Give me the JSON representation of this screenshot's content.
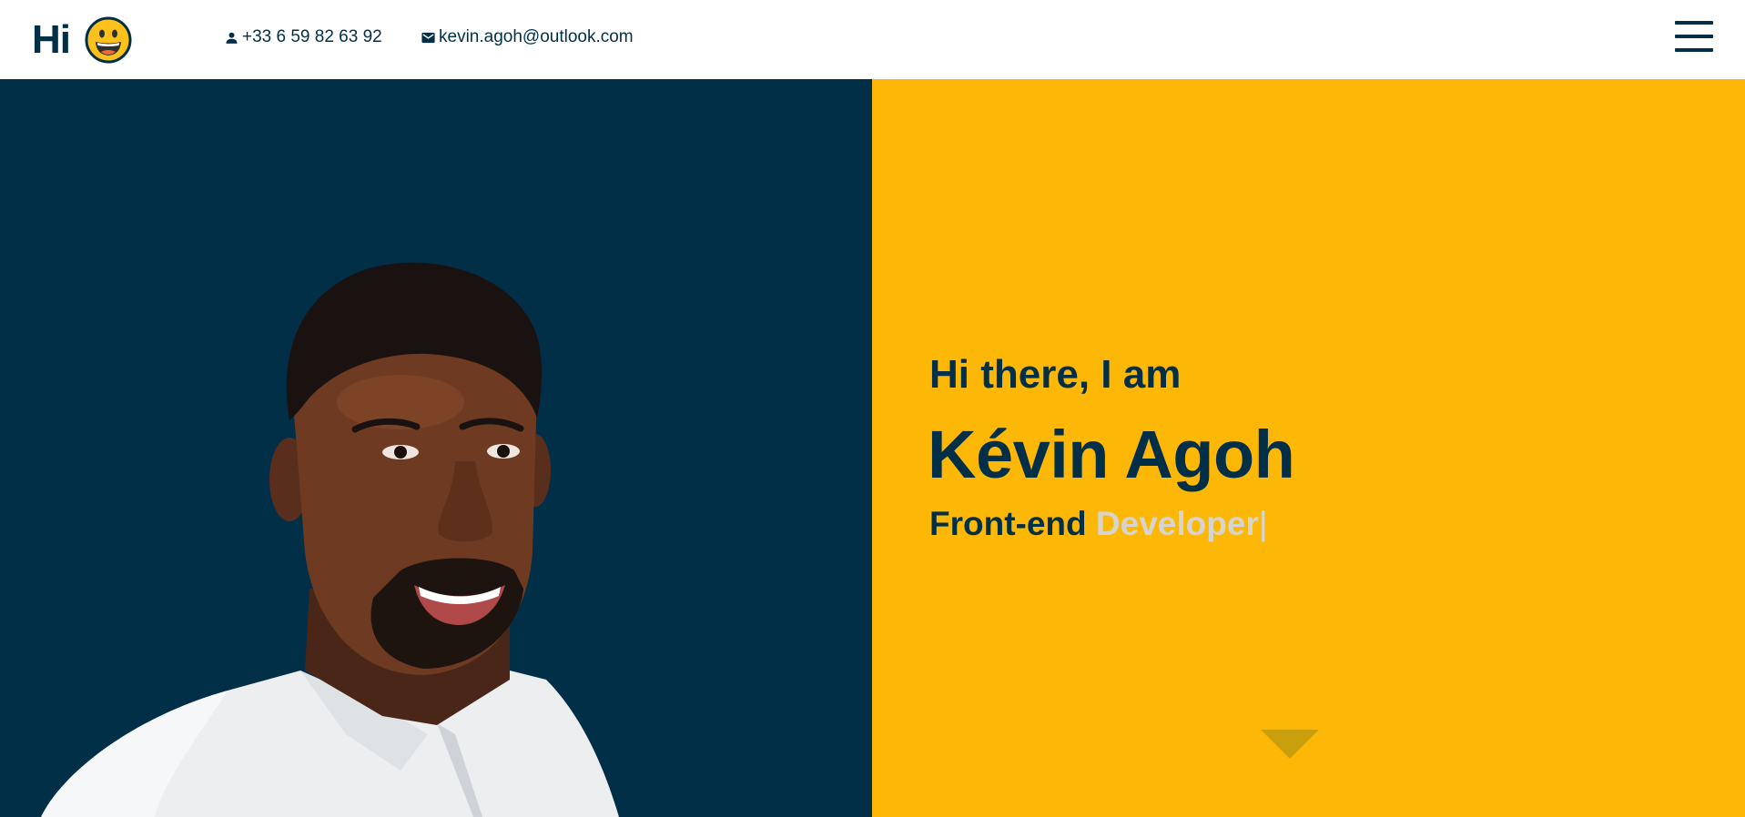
{
  "header": {
    "logo_text": "Hi",
    "logo_emoji": "grinning-face-icon",
    "phone": "+33 6 59 82 63 92",
    "email": "kevin.agoh@outlook.com",
    "menu_icon": "hamburger-menu-icon"
  },
  "hero": {
    "greeting": "Hi there, I am",
    "name": "Kévin Agoh",
    "role_prefix": "Front-end",
    "role_typed": "Developer",
    "cursor": "|",
    "scroll_icon": "triangle-down-icon"
  },
  "colors": {
    "navy": "#022f48",
    "yellow": "#fdb706",
    "typed_text": "#d6d4cf"
  }
}
